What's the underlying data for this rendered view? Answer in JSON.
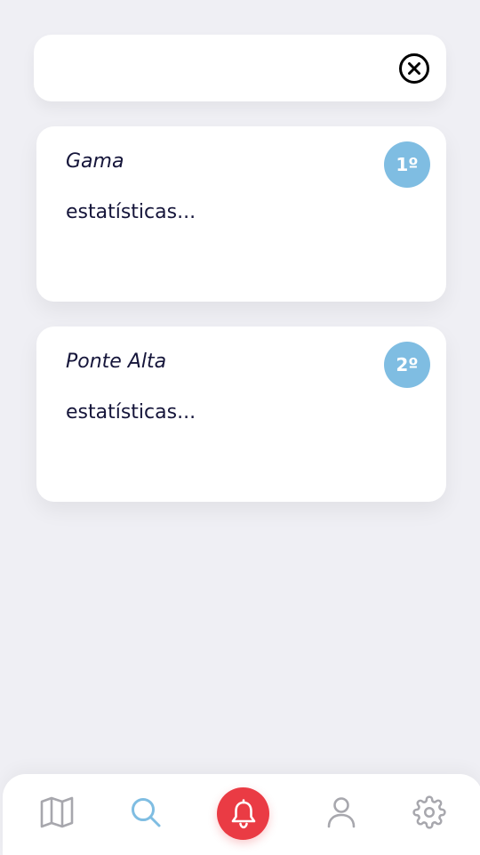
{
  "search": {
    "value": "",
    "placeholder": ""
  },
  "results": [
    {
      "name": "Gama",
      "stats": "estatísticas...",
      "rank": "1º"
    },
    {
      "name": "Ponte Alta",
      "stats": "estatísticas...",
      "rank": "2º"
    }
  ],
  "tab_bar": {
    "items": [
      {
        "icon": "map-icon",
        "active": false
      },
      {
        "icon": "search-icon",
        "active": true
      },
      {
        "icon": "bell-icon",
        "primary": true
      },
      {
        "icon": "user-icon",
        "active": false
      },
      {
        "icon": "gear-icon",
        "active": false
      }
    ]
  },
  "colors": {
    "background": "#efeff4",
    "card": "#ffffff",
    "text": "#15153a",
    "badge": "#7fbde2",
    "active_tab": "#7fbde2",
    "inactive_tab": "#a7a7ad",
    "alert": "#ea3b44"
  }
}
